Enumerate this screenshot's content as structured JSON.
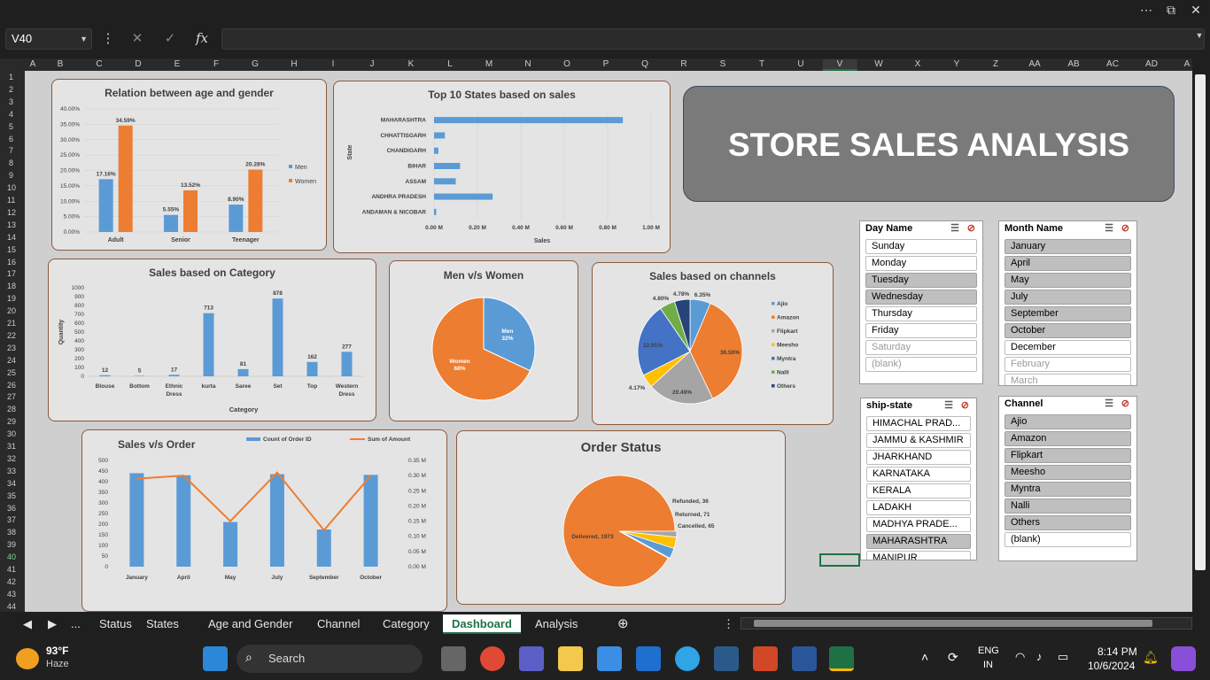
{
  "excel": {
    "namebox": "V40",
    "fx_label": "fx"
  },
  "columns": [
    "A",
    "B",
    "C",
    "D",
    "E",
    "F",
    "G",
    "H",
    "I",
    "J",
    "K",
    "L",
    "M",
    "N",
    "O",
    "P",
    "Q",
    "R",
    "S",
    "T",
    "U",
    "V",
    "W",
    "X",
    "Y",
    "Z",
    "AA",
    "AB",
    "AC",
    "AD",
    "A"
  ],
  "rows": [
    "1",
    "2",
    "3",
    "4",
    "5",
    "6",
    "7",
    "8",
    "9",
    "10",
    "11",
    "12",
    "13",
    "14",
    "15",
    "16",
    "17",
    "18",
    "19",
    "20",
    "21",
    "22",
    "23",
    "24",
    "25",
    "26",
    "27",
    "28",
    "29",
    "30",
    "31",
    "32",
    "33",
    "34",
    "35",
    "36",
    "37",
    "38",
    "39",
    "40",
    "41",
    "42",
    "43",
    "44"
  ],
  "banner": {
    "title": "STORE SALES ANALYSIS"
  },
  "chart_data": [
    {
      "type": "bar",
      "title": "Relation between age and gender",
      "categories": [
        "Adult",
        "Senior",
        "Teenager"
      ],
      "series": [
        {
          "name": "Men",
          "values": [
            17.16,
            5.55,
            8.9
          ],
          "labels": [
            "17.16%",
            "5.55%",
            "8.90%"
          ]
        },
        {
          "name": "Women",
          "values": [
            34.59,
            13.52,
            20.28
          ],
          "labels": [
            "34.59%",
            "13.52%",
            "20.28%"
          ]
        }
      ],
      "ylim": [
        0,
        40
      ],
      "yticks": [
        "0.00%",
        "5.00%",
        "10.00%",
        "15.00%",
        "20.00%",
        "25.00%",
        "30.00%",
        "35.00%",
        "40.00%"
      ],
      "legend": "right"
    },
    {
      "type": "bar",
      "orientation": "horizontal",
      "title": "Top 10 States based on sales",
      "ylabel": "State",
      "xlabel": "Sales",
      "categories": [
        "MAHARASHTRA",
        "CHHATTISGARH",
        "CHANDIGARH",
        "BIHAR",
        "ASSAM",
        "ANDHRA PRADESH",
        "ANDAMAN & NICOBAR"
      ],
      "values": [
        0.87,
        0.05,
        0.02,
        0.12,
        0.1,
        0.27,
        0.01
      ],
      "xlim": [
        0,
        1
      ],
      "xticks": [
        "0.00 M",
        "0.20 M",
        "0.40 M",
        "0.60 M",
        "0.80 M",
        "1.00 M"
      ]
    },
    {
      "type": "bar",
      "title": "Sales based on Category",
      "ylabel": "Quantity",
      "xlabel": "Category",
      "categories": [
        "Blouse",
        "Bottom",
        "Ethnic Dress",
        "kurta",
        "Saree",
        "Set",
        "Top",
        "Western Dress"
      ],
      "values": [
        12,
        5,
        17,
        713,
        81,
        878,
        162,
        277
      ],
      "ylim": [
        0,
        1000
      ],
      "yticks": [
        "0",
        "100",
        "200",
        "300",
        "400",
        "500",
        "600",
        "700",
        "800",
        "900",
        "1000"
      ]
    },
    {
      "type": "pie",
      "title": "Men v/s Women",
      "slices": [
        {
          "name": "Women",
          "value": 68,
          "label": "68%"
        },
        {
          "name": "Men",
          "value": 32,
          "label": "32%"
        }
      ]
    },
    {
      "type": "pie",
      "title": "Sales based on channels",
      "slices": [
        {
          "name": "Ajio",
          "value": 6.35,
          "label": "6.35%"
        },
        {
          "name": "Amazon",
          "value": 36.5,
          "label": "36.50%"
        },
        {
          "name": "Flipkart",
          "value": 20.49,
          "label": "20.49%"
        },
        {
          "name": "Meesho",
          "value": 4.17,
          "label": "4.17%"
        },
        {
          "name": "Myntra",
          "value": 22.91,
          "label": "22.91%"
        },
        {
          "name": "Nalli",
          "value": 4.8,
          "label": "4.80%"
        },
        {
          "name": "Others",
          "value": 4.78,
          "label": "4.78%"
        }
      ],
      "legend": "right"
    },
    {
      "type": "bar",
      "title": "Sales v/s Order",
      "categories": [
        "January",
        "April",
        "May",
        "July",
        "September",
        "October"
      ],
      "series": [
        {
          "name": "Count of Order ID",
          "type": "bar",
          "values": [
            440,
            430,
            210,
            435,
            175,
            432
          ]
        },
        {
          "name": "Sum of Amount",
          "type": "line",
          "axis": "right",
          "values": [
            0.29,
            0.3,
            0.15,
            0.31,
            0.12,
            0.3
          ]
        }
      ],
      "ylim": [
        0,
        500
      ],
      "y2lim": [
        0,
        0.35
      ],
      "yticks": [
        "0",
        "50",
        "100",
        "150",
        "200",
        "250",
        "300",
        "350",
        "400",
        "450",
        "500"
      ],
      "y2ticks": [
        "0.00 M",
        "0.05 M",
        "0.10 M",
        "0.15 M",
        "0.20 M",
        "0.25 M",
        "0.30 M",
        "0.35 M"
      ],
      "legend": "top"
    },
    {
      "type": "pie",
      "title": "Order Status",
      "slices": [
        {
          "name": "Delivered",
          "value": 1973,
          "label": "Delivered, 1973"
        },
        {
          "name": "Cancelled",
          "value": 65,
          "label": "Cancelled, 65"
        },
        {
          "name": "Returned",
          "value": 71,
          "label": "Returned, 71"
        },
        {
          "name": "Refunded",
          "value": 36,
          "label": "Refunded, 36"
        }
      ]
    }
  ],
  "colors": {
    "blue": "#5b9bd5",
    "orange": "#ed7d31",
    "gray": "#a5a5a5",
    "yellow": "#ffc000",
    "darkblue": "#4472c4",
    "green": "#70ad47",
    "navy": "#264478"
  },
  "slicers": {
    "day": {
      "title": "Day Name",
      "items": [
        "Sunday",
        "Monday",
        "Tuesday",
        "Wednesday",
        "Thursday",
        "Friday",
        "Saturday",
        "(blank)"
      ]
    },
    "month": {
      "title": "Month Name",
      "items": [
        "January",
        "April",
        "May",
        "July",
        "September",
        "October",
        "December",
        "February",
        "March"
      ]
    },
    "state": {
      "title": "ship-state",
      "items": [
        "HIMACHAL PRAD...",
        "JAMMU & KASHMIR",
        "JHARKHAND",
        "KARNATAKA",
        "KERALA",
        "LADAKH",
        "MADHYA PRADE...",
        "MAHARASHTRA",
        "MANIPUR"
      ]
    },
    "channel": {
      "title": "Channel",
      "items": [
        "Ajio",
        "Amazon",
        "Flipkart",
        "Meesho",
        "Myntra",
        "Nalli",
        "Others",
        "(blank)"
      ]
    }
  },
  "tabs": {
    "more": "...",
    "items": [
      "Status",
      "States",
      "Age and Gender",
      "Channel",
      "Category",
      "Dashboard",
      "Analysis"
    ],
    "active": "Dashboard"
  },
  "taskbar": {
    "temp": "93°F",
    "weather": "Haze",
    "search": "Search",
    "lang1": "ENG",
    "lang2": "IN",
    "time": "8:14 PM",
    "date": "10/6/2024"
  }
}
